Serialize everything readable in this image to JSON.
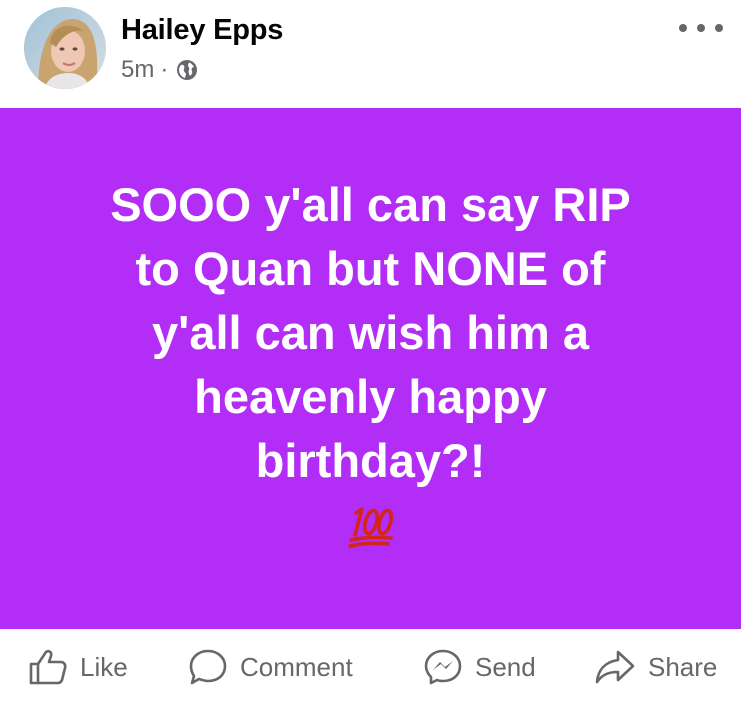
{
  "post": {
    "author": "Hailey Epps",
    "time": "5m",
    "separator": "·",
    "privacy_icon": "globe-icon",
    "menu_icon": "more-horizontal-icon",
    "status_text": "SOOO y'all can say RIP\nto Quan but NONE of\ny'all can wish him a\nheavenly happy\nbirthday?!",
    "emoji": "hundred-points-emoji",
    "background_color": "#b22ef6"
  },
  "actions": {
    "like": "Like",
    "comment": "Comment",
    "send": "Send",
    "share": "Share"
  },
  "colors": {
    "text_primary": "#050505",
    "text_secondary": "#65676b",
    "emoji_red": "#d3251a"
  }
}
